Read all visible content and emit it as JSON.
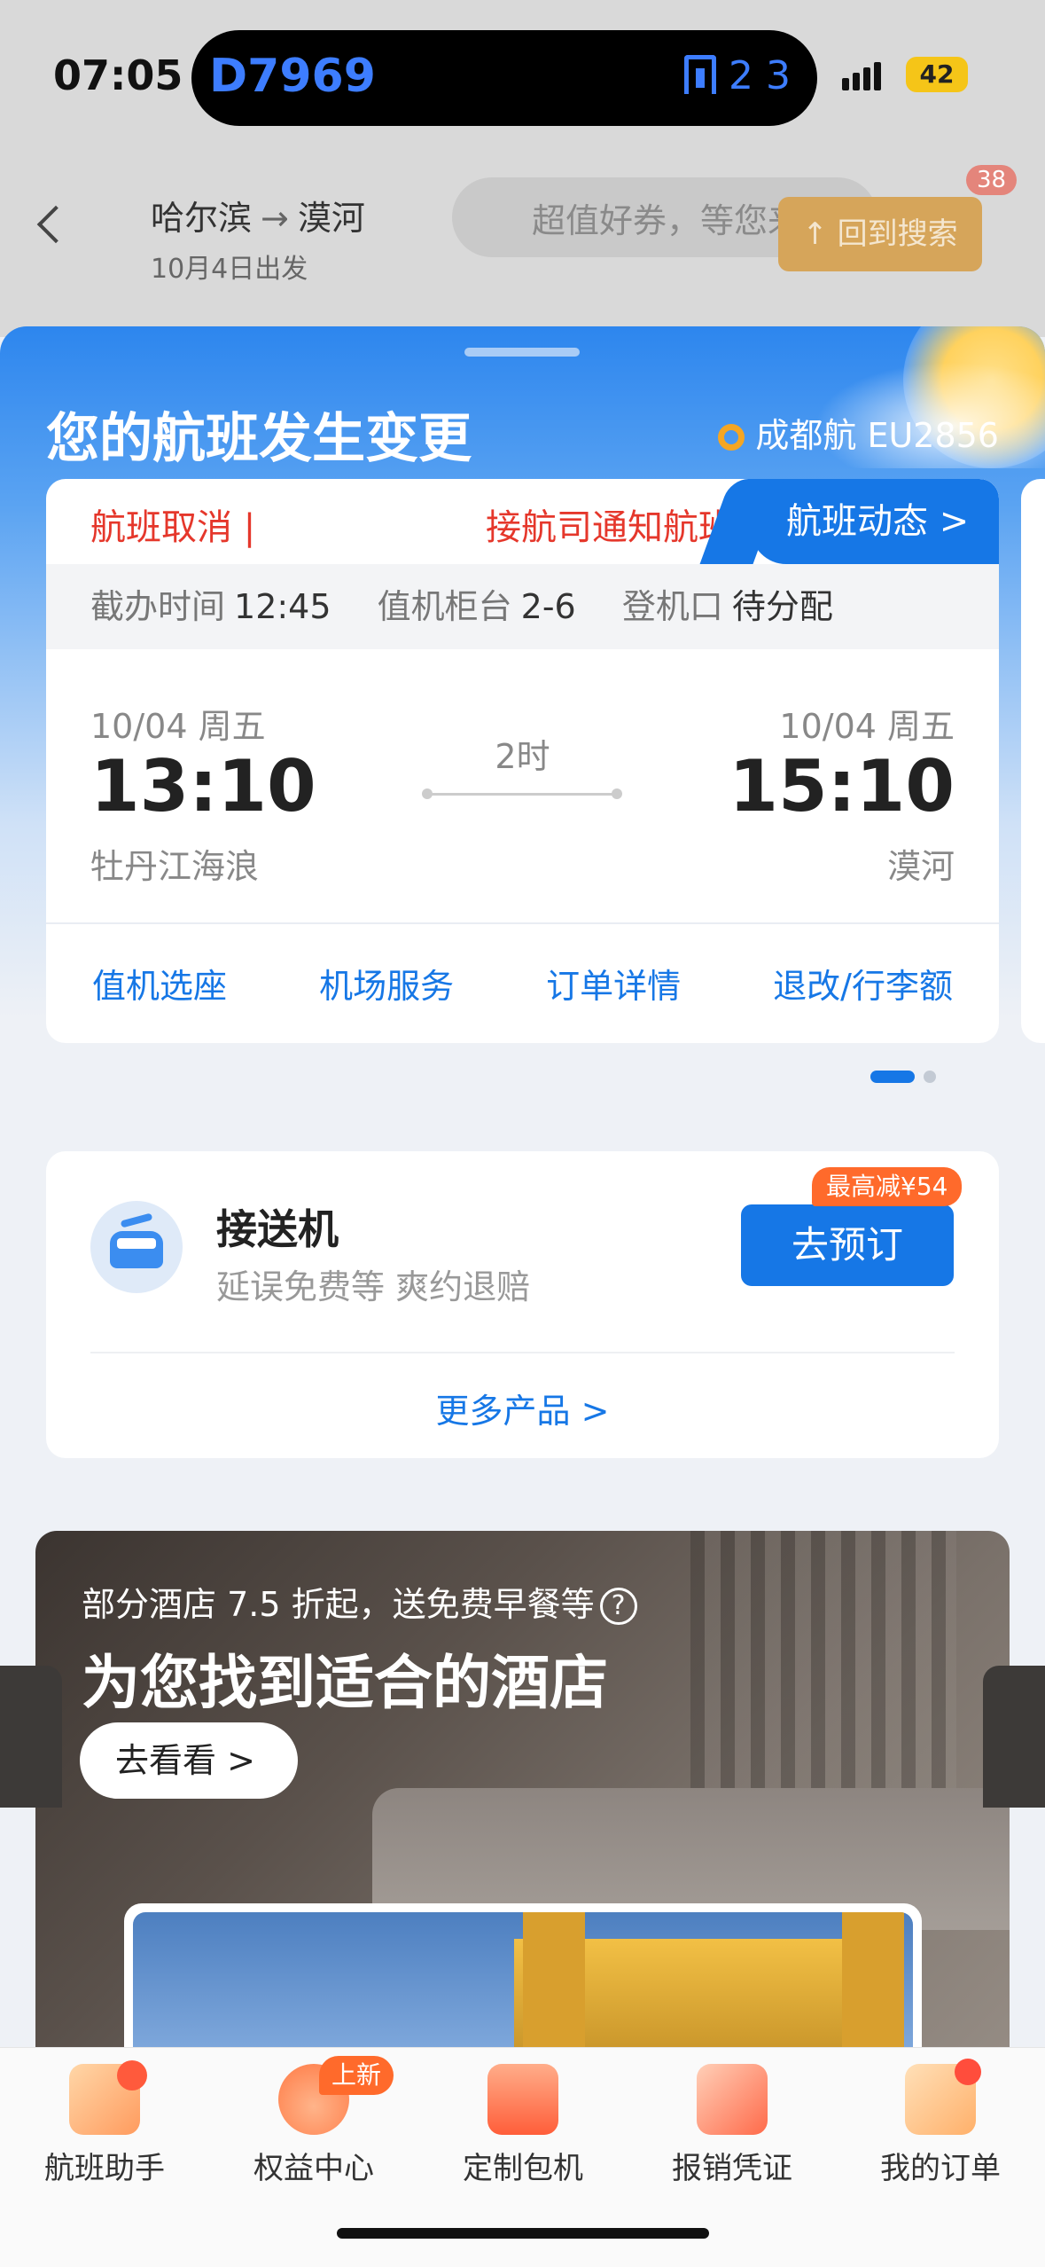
{
  "status_bar": {
    "time": "07:05",
    "live_activity": {
      "flight_code": "D7969",
      "gate": "2 3"
    },
    "battery": "42"
  },
  "background_page": {
    "route_from": "哈尔滨",
    "route_to": "漠河",
    "date": "10月4日出发",
    "coupon_text": "超值好券，等您来领",
    "search_button": "回到搜索",
    "badge_count": "38"
  },
  "sheet": {
    "title": "您的航班发生变更",
    "next_flight": "成都航 EU2856",
    "flight_card": {
      "status_label": "航班取消 |",
      "notice": "接航司通知航班",
      "dynamic_tab": "航班动态 >",
      "info": {
        "checkin_deadline_label": "截办时间",
        "checkin_deadline": "12:45",
        "counter_label": "值机柜台",
        "counter": "2-6",
        "gate_label": "登机口",
        "gate": "待分配"
      },
      "departure": {
        "date": "10/04 周五",
        "time": "13:10",
        "city": "牡丹江海浪"
      },
      "arrival": {
        "date": "10/04 周五",
        "time": "15:10",
        "city": "漠河"
      },
      "duration": "2时",
      "actions": [
        "值机选座",
        "机场服务",
        "订单详情",
        "退改/行李额"
      ]
    },
    "pager": {
      "current": 1,
      "total": 2
    },
    "transfer": {
      "title": "接送机",
      "subtitle": "延误免费等 爽约退赔",
      "promo": "最高减¥54",
      "button": "去预订",
      "more": "更多产品 >"
    },
    "hotel": {
      "subtitle": "部分酒店 7.5 折起，送免费早餐等",
      "title": "为您找到适合的酒店",
      "button": "去看看 >"
    }
  },
  "tabbar": {
    "items": [
      {
        "label": "航班助手",
        "icon": "flight-assistant-icon"
      },
      {
        "label": "权益中心",
        "icon": "rights-center-icon",
        "badge": "上新"
      },
      {
        "label": "定制包机",
        "icon": "charter-icon"
      },
      {
        "label": "报销凭证",
        "icon": "receipt-icon"
      },
      {
        "label": "我的订单",
        "icon": "my-orders-icon"
      }
    ]
  },
  "colors": {
    "accent": "#1677e6",
    "alert": "#e5372b",
    "promo": "#ff6a2b"
  }
}
